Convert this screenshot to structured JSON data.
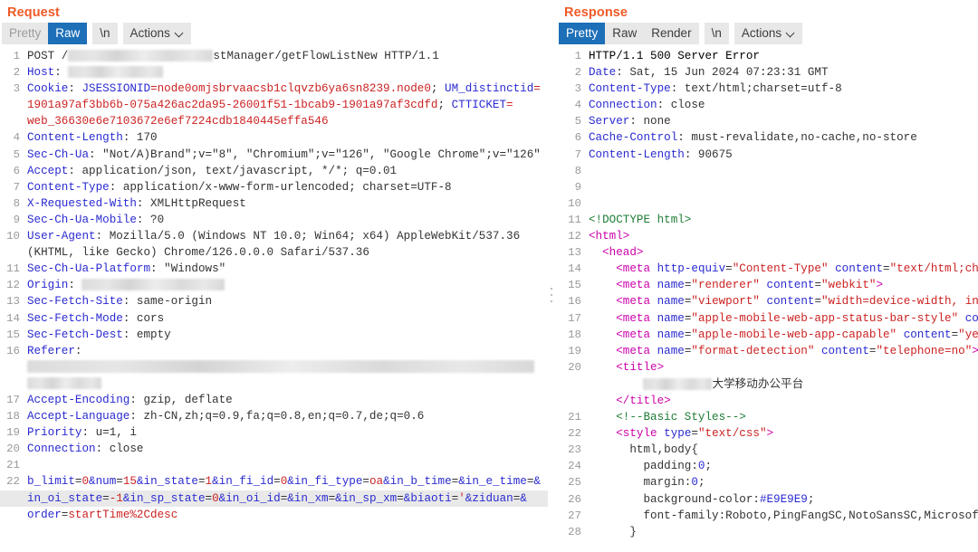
{
  "request": {
    "title": "Request",
    "tabs": [
      {
        "label": "Pretty",
        "active": false,
        "muted": true
      },
      {
        "label": "Raw",
        "active": true,
        "muted": false
      },
      {
        "label": "\\n",
        "active": false,
        "muted": false
      }
    ],
    "actions_label": "Actions",
    "lines": [
      {
        "n": "1",
        "text": "POST /█████ stManager/getFlowListNew HTTP/1.1"
      },
      {
        "n": "2",
        "text": "Host: █████"
      },
      {
        "n": "3",
        "text": "Cookie: JSESSIONID=node0omjsbrvaacsb1clqvzb6ya6sn8239.node0; UM_distinctid="
      },
      {
        "n": "",
        "text": "1901a97af3bb6b-075a426ac2da95-26001f51-1bcab9-1901a97af3cdfd; CTTICKET="
      },
      {
        "n": "",
        "text": "web_36630e6e7103672e6ef7224cdb1840445effa546"
      },
      {
        "n": "4",
        "text": "Content-Length: 170"
      },
      {
        "n": "5",
        "text": "Sec-Ch-Ua: \"Not/A)Brand\";v=\"8\", \"Chromium\";v=\"126\", \"Google Chrome\";v=\"126\""
      },
      {
        "n": "6",
        "text": "Accept: application/json, text/javascript, */*; q=0.01"
      },
      {
        "n": "7",
        "text": "Content-Type: application/x-www-form-urlencoded; charset=UTF-8"
      },
      {
        "n": "8",
        "text": "X-Requested-With: XMLHttpRequest"
      },
      {
        "n": "9",
        "text": "Sec-Ch-Ua-Mobile: ?0"
      },
      {
        "n": "10",
        "text": "User-Agent: Mozilla/5.0 (Windows NT 10.0; Win64; x64) AppleWebKit/537.36"
      },
      {
        "n": "",
        "text": "(KHTML, like Gecko) Chrome/126.0.0.0 Safari/537.36"
      },
      {
        "n": "11",
        "text": "Sec-Ch-Ua-Platform: \"Windows\""
      },
      {
        "n": "12",
        "text": "Origin: █████"
      },
      {
        "n": "13",
        "text": "Sec-Fetch-Site: same-origin"
      },
      {
        "n": "14",
        "text": "Sec-Fetch-Mode: cors"
      },
      {
        "n": "15",
        "text": "Sec-Fetch-Dest: empty"
      },
      {
        "n": "16",
        "text": "Referer:"
      },
      {
        "n": "",
        "text": "██████████"
      },
      {
        "n": "",
        "text": "███"
      },
      {
        "n": "17",
        "text": "Accept-Encoding: gzip, deflate"
      },
      {
        "n": "18",
        "text": "Accept-Language: zh-CN,zh;q=0.9,fa;q=0.8,en;q=0.7,de;q=0.6"
      },
      {
        "n": "19",
        "text": "Priority: u=1, i"
      },
      {
        "n": "20",
        "text": "Connection: close"
      },
      {
        "n": "21",
        "text": ""
      },
      {
        "n": "22",
        "text": "b_limit=0&num=15&in_state=1&in_fi_id=0&in_fi_type=oa&in_b_time=&in_e_time=&"
      },
      {
        "n": "",
        "text": "in_oi_state=-1&in_sp_state=0&in_oi_id=&in_xm=&in_sp_xm=&biaoti='&ziduan=&"
      },
      {
        "n": "",
        "text": "order=startTime%2Cdesc"
      }
    ]
  },
  "response": {
    "title": "Response",
    "tabs": [
      {
        "label": "Pretty",
        "active": true,
        "muted": false
      },
      {
        "label": "Raw",
        "active": false,
        "muted": false
      },
      {
        "label": "Render",
        "active": false,
        "muted": false
      },
      {
        "label": "\\n",
        "active": false,
        "muted": false
      }
    ],
    "actions_label": "Actions",
    "status_line": "HTTP/1.1 500 Server Error",
    "lines": [
      {
        "n": "1",
        "text": "HTTP/1.1 500 Server Error"
      },
      {
        "n": "2",
        "text": "Date: Sat, 15 Jun 2024 07:23:31 GMT"
      },
      {
        "n": "3",
        "text": "Content-Type: text/html;charset=utf-8"
      },
      {
        "n": "4",
        "text": "Connection: close"
      },
      {
        "n": "5",
        "text": "Server: none"
      },
      {
        "n": "6",
        "text": "Cache-Control: must-revalidate,no-cache,no-store"
      },
      {
        "n": "7",
        "text": "Content-Length: 90675"
      },
      {
        "n": "8",
        "text": ""
      },
      {
        "n": "9",
        "text": ""
      },
      {
        "n": "10",
        "text": ""
      },
      {
        "n": "11",
        "text": "<!DOCTYPE html>"
      },
      {
        "n": "12",
        "text": "<html>"
      },
      {
        "n": "13",
        "text": "  <head>"
      },
      {
        "n": "14",
        "text": "    <meta http-equiv=\"Content-Type\" content=\"text/html;ch"
      },
      {
        "n": "15",
        "text": "    <meta name=\"renderer\" content=\"webkit\">"
      },
      {
        "n": "16",
        "text": "    <meta name=\"viewport\" content=\"width=device-width, in"
      },
      {
        "n": "17",
        "text": "    <meta name=\"apple-mobile-web-app-status-bar-style\" co"
      },
      {
        "n": "18",
        "text": "    <meta name=\"apple-mobile-web-app-capable\" content=\"ye"
      },
      {
        "n": "19",
        "text": "    <meta name=\"format-detection\" content=\"telephone=no\">"
      },
      {
        "n": "20",
        "text": "    <title>"
      },
      {
        "n": "",
        "text": "        ████ 大学移动办公平台"
      },
      {
        "n": "",
        "text": "    </title>"
      },
      {
        "n": "21",
        "text": "    <!--Basic Styles-->"
      },
      {
        "n": "22",
        "text": "    <style type=\"text/css\">"
      },
      {
        "n": "23",
        "text": "      html,body{"
      },
      {
        "n": "24",
        "text": "        padding:0;"
      },
      {
        "n": "25",
        "text": "        margin:0;"
      },
      {
        "n": "26",
        "text": "        background-color:#E9E9E9;"
      },
      {
        "n": "27",
        "text": "        font-family:Roboto,PingFangSC,NotoSansSC,Microsof"
      },
      {
        "n": "28",
        "text": "      }"
      }
    ],
    "title_tag_cjk": "大学移动办公平台"
  },
  "colors": {
    "heading": "#f05a28",
    "tab_active_bg": "#1d6fb8",
    "tab_bg": "#e8e8e8",
    "header_name": "#2a2ad1",
    "string": "#cc2222",
    "tag": "#cc00aa",
    "comment": "#1e7d35",
    "highlight": "#e9e9e9"
  },
  "splitter": {
    "name": "panel-splitter"
  }
}
